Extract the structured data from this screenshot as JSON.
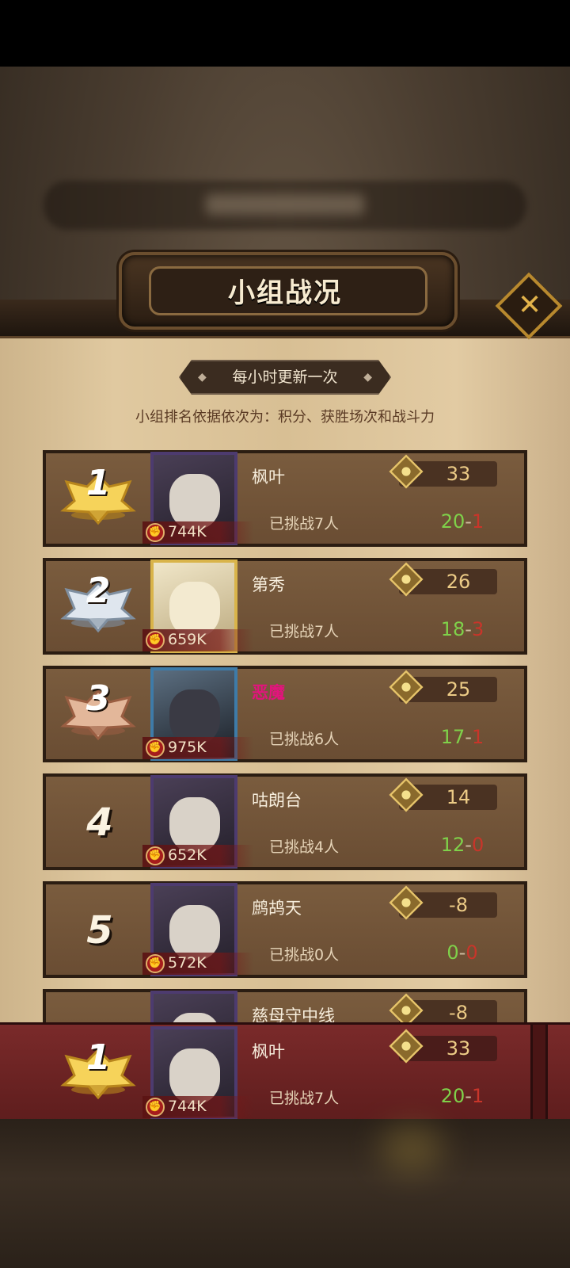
{
  "header": {
    "title": "小组战况",
    "update_notice": "每小时更新一次",
    "rule_text": "小组排名依据依次为：积分、获胜场次和战斗力"
  },
  "close_icon": "close-icon",
  "side_tab_glyph": "N",
  "players": [
    {
      "rank": "1",
      "rank_style": "gold-medal",
      "name": "枫叶",
      "power": "744K",
      "score": "33",
      "challenged": "已挑战7人",
      "wins": "20",
      "losses": "1",
      "frame": "purple",
      "name_color": ""
    },
    {
      "rank": "2",
      "rank_style": "silver-medal",
      "name": "第秀",
      "power": "659K",
      "score": "26",
      "challenged": "已挑战7人",
      "wins": "18",
      "losses": "3",
      "frame": "gold",
      "name_color": ""
    },
    {
      "rank": "3",
      "rank_style": "bronze-medal",
      "name": "恶魔",
      "power": "975K",
      "score": "25",
      "challenged": "已挑战6人",
      "wins": "17",
      "losses": "1",
      "frame": "blue",
      "name_color": "#e3137d"
    },
    {
      "rank": "4",
      "rank_style": "number",
      "name": "咕朗台",
      "power": "652K",
      "score": "14",
      "challenged": "已挑战4人",
      "wins": "12",
      "losses": "0",
      "frame": "purple",
      "name_color": ""
    },
    {
      "rank": "5",
      "rank_style": "number",
      "name": "鹧鸪天",
      "power": "572K",
      "score": "-8",
      "challenged": "已挑战0人",
      "wins": "0",
      "losses": "0",
      "frame": "purple",
      "name_color": ""
    },
    {
      "rank": "",
      "rank_style": "number",
      "name": "慈母守中线",
      "power": "",
      "score": "-8",
      "challenged": "",
      "wins": "",
      "losses": "",
      "frame": "purple",
      "name_color": ""
    }
  ],
  "self": {
    "rank": "1",
    "name": "枫叶",
    "power": "744K",
    "score": "33",
    "challenged": "已挑战7人",
    "wins": "20",
    "losses": "1"
  },
  "separator": "-",
  "colors": {
    "wins": "#7fd14a",
    "losses": "#c8352a",
    "panel": "#d8bf94",
    "self_bar": "#6e2424"
  }
}
